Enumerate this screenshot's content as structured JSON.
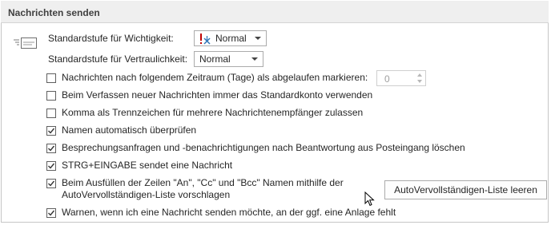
{
  "section": {
    "title": "Nachrichten senden",
    "icon": "send-message-icon"
  },
  "importance": {
    "label": "Standardstufe für Wichtigkeit:",
    "value": "Normal"
  },
  "sensitivity": {
    "label": "Standardstufe für Vertraulichkeit:",
    "value": "Normal"
  },
  "options": [
    {
      "label": "Nachrichten nach folgendem Zeitraum (Tage) als abgelaufen markieren:",
      "checked": false
    },
    {
      "label": "Beim Verfassen neuer Nachrichten immer das Standardkonto verwenden",
      "checked": false
    },
    {
      "label": "Komma als Trennzeichen für mehrere Nachrichtenempfänger zulassen",
      "checked": false
    },
    {
      "label": "Namen automatisch überprüfen",
      "checked": true
    },
    {
      "label": "Besprechungsanfragen und -benachrichtigungen nach Beantwortung aus Posteingang löschen",
      "checked": true
    },
    {
      "label": "STRG+EINGABE sendet eine Nachricht",
      "checked": true
    },
    {
      "label_line1": "Beim Ausfüllen der Zeilen \"An\", \"Cc\" und \"Bcc\" Namen mithilfe der",
      "label_line2": "AutoVervollständigen-Liste vorschlagen",
      "checked": true
    },
    {
      "label": "Warnen, wenn ich eine Nachricht senden möchte, an der ggf. eine Anlage fehlt",
      "checked": true
    }
  ],
  "expiry_days": {
    "value": "0"
  },
  "clear_autocomplete_button": {
    "label": "AutoVervollständigen-Liste leeren"
  },
  "colors": {
    "header_bg": "#efefef",
    "importance_icon_red": "#c00000",
    "importance_icon_blue": "#2e75b6"
  }
}
